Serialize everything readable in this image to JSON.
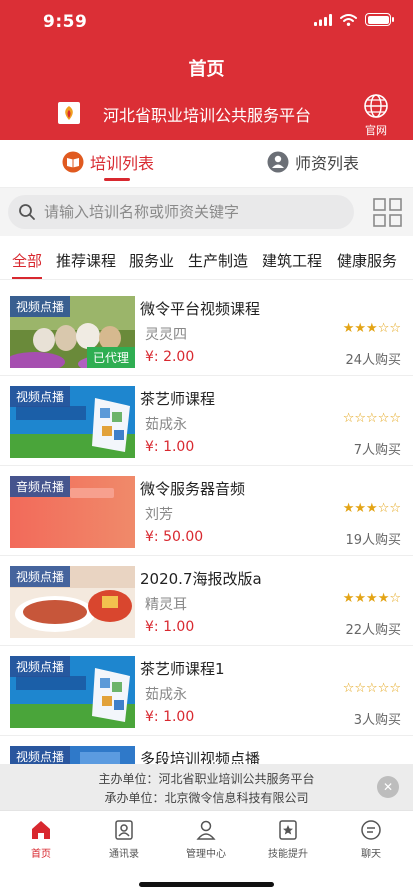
{
  "status_bar": {
    "time": "9:59"
  },
  "header": {
    "title": "首页",
    "platform_name": "河北省职业培训公共服务平台",
    "official_site_label": "官网"
  },
  "segment_tabs": {
    "training": "培训列表",
    "teachers": "师资列表"
  },
  "search": {
    "placeholder": "请输入培训名称或师资关键字"
  },
  "categories": [
    "全部",
    "推荐课程",
    "服务业",
    "生产制造",
    "建筑工程",
    "健康服务"
  ],
  "courses": [
    {
      "tag": "视频点播",
      "badge": "已代理",
      "title": "微令平台视频课程",
      "teacher": "灵灵四",
      "price": "¥: 2.00",
      "stars": 3,
      "buyers": "24人购买"
    },
    {
      "tag": "视频点播",
      "badge": "",
      "title": "茶艺师课程",
      "teacher": "茹成永",
      "price": "¥: 1.00",
      "stars": 0,
      "buyers": "7人购买"
    },
    {
      "tag": "音频点播",
      "badge": "",
      "title": "微令服务器音频",
      "teacher": "刘芳",
      "price": "¥: 50.00",
      "stars": 3,
      "buyers": "19人购买"
    },
    {
      "tag": "视频点播",
      "badge": "",
      "title": "2020.7海报改版a",
      "teacher": "精灵耳",
      "price": "¥: 1.00",
      "stars": 4,
      "buyers": "22人购买"
    },
    {
      "tag": "视频点播",
      "badge": "",
      "title": "茶艺师课程1",
      "teacher": "茹成永",
      "price": "¥: 1.00",
      "stars": 0,
      "buyers": "3人购买"
    },
    {
      "tag": "视频点播",
      "badge": "",
      "title": "多段培训视频点播",
      "teacher": "",
      "price": "",
      "stars": 0,
      "buyers": ""
    }
  ],
  "footer": {
    "host": "主办单位：河北省职业培训公共服务平台",
    "organizer": "承办单位：北京微令信息科技有限公司"
  },
  "bottom_nav": [
    "首页",
    "通讯录",
    "管理中心",
    "技能提升",
    "聊天"
  ],
  "colors": {
    "brand_red": "#db2f36",
    "accent_red": "#d8282f",
    "star": "#e3a416",
    "agent_green": "#2fae52"
  }
}
